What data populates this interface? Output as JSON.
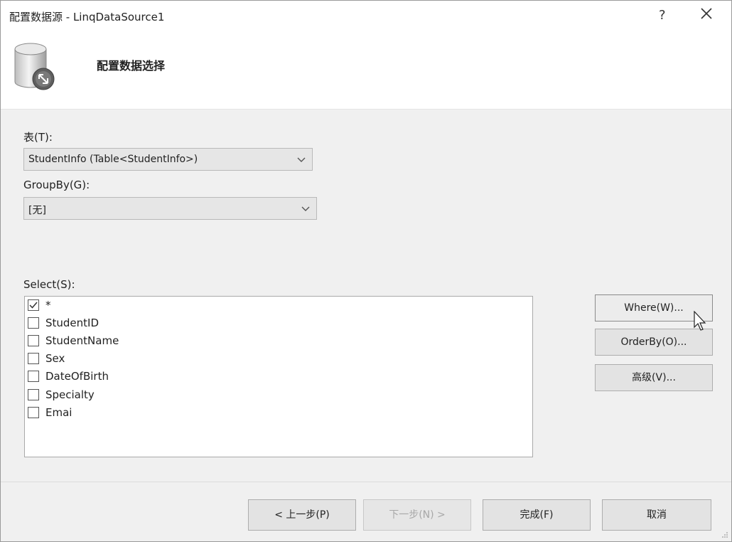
{
  "window": {
    "title": "配置数据源 - LinqDataSource1",
    "help_label": "?",
    "close_label": "✕"
  },
  "header": {
    "title": "配置数据选择",
    "icon": "database-icon"
  },
  "table_field": {
    "label": "表(T):",
    "value": "StudentInfo (Table<StudentInfo>)"
  },
  "groupby_field": {
    "label": "GroupBy(G):",
    "value": "[无]"
  },
  "select_list": {
    "label": "Select(S):",
    "items": [
      {
        "label": "*",
        "checked": true
      },
      {
        "label": "StudentID",
        "checked": false
      },
      {
        "label": "StudentName",
        "checked": false
      },
      {
        "label": "Sex",
        "checked": false
      },
      {
        "label": "DateOfBirth",
        "checked": false
      },
      {
        "label": "Specialty",
        "checked": false
      },
      {
        "label": "Emai",
        "checked": false
      }
    ]
  },
  "side_buttons": {
    "where": "Where(W)...",
    "orderby": "OrderBy(O)...",
    "advanced": "高级(V)..."
  },
  "footer_buttons": {
    "back": "< 上一步(P)",
    "next": "下一步(N) >",
    "finish": "完成(F)",
    "cancel": "取消"
  }
}
